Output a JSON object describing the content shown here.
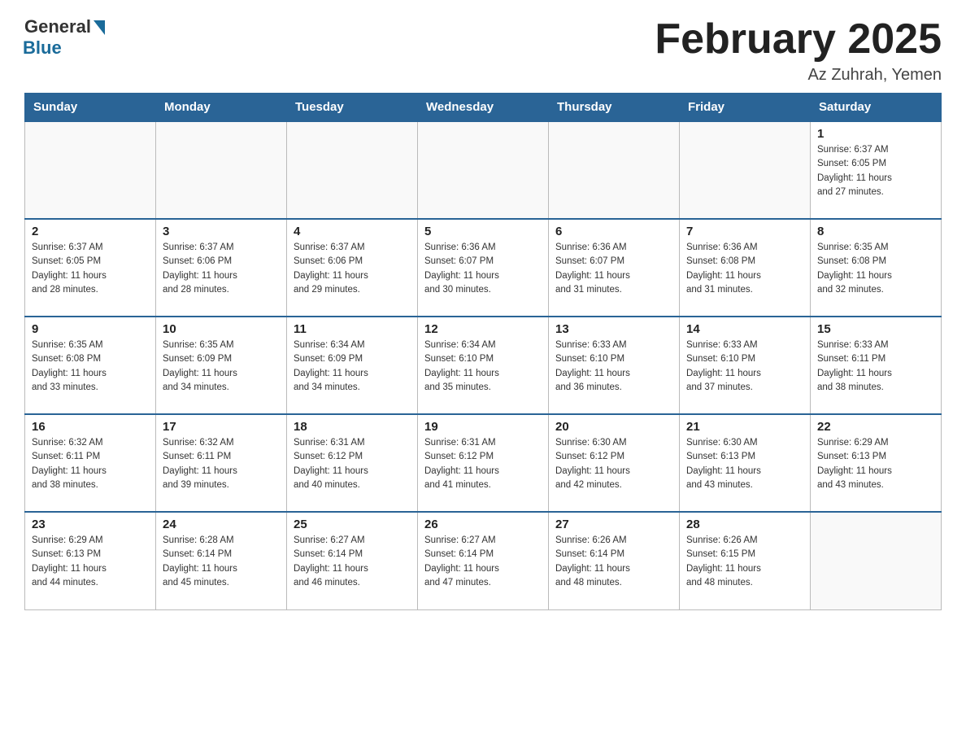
{
  "header": {
    "logo_general": "General",
    "logo_blue": "Blue",
    "month_title": "February 2025",
    "location": "Az Zuhrah, Yemen"
  },
  "weekdays": [
    "Sunday",
    "Monday",
    "Tuesday",
    "Wednesday",
    "Thursday",
    "Friday",
    "Saturday"
  ],
  "weeks": [
    [
      {
        "day": "",
        "info": ""
      },
      {
        "day": "",
        "info": ""
      },
      {
        "day": "",
        "info": ""
      },
      {
        "day": "",
        "info": ""
      },
      {
        "day": "",
        "info": ""
      },
      {
        "day": "",
        "info": ""
      },
      {
        "day": "1",
        "info": "Sunrise: 6:37 AM\nSunset: 6:05 PM\nDaylight: 11 hours\nand 27 minutes."
      }
    ],
    [
      {
        "day": "2",
        "info": "Sunrise: 6:37 AM\nSunset: 6:05 PM\nDaylight: 11 hours\nand 28 minutes."
      },
      {
        "day": "3",
        "info": "Sunrise: 6:37 AM\nSunset: 6:06 PM\nDaylight: 11 hours\nand 28 minutes."
      },
      {
        "day": "4",
        "info": "Sunrise: 6:37 AM\nSunset: 6:06 PM\nDaylight: 11 hours\nand 29 minutes."
      },
      {
        "day": "5",
        "info": "Sunrise: 6:36 AM\nSunset: 6:07 PM\nDaylight: 11 hours\nand 30 minutes."
      },
      {
        "day": "6",
        "info": "Sunrise: 6:36 AM\nSunset: 6:07 PM\nDaylight: 11 hours\nand 31 minutes."
      },
      {
        "day": "7",
        "info": "Sunrise: 6:36 AM\nSunset: 6:08 PM\nDaylight: 11 hours\nand 31 minutes."
      },
      {
        "day": "8",
        "info": "Sunrise: 6:35 AM\nSunset: 6:08 PM\nDaylight: 11 hours\nand 32 minutes."
      }
    ],
    [
      {
        "day": "9",
        "info": "Sunrise: 6:35 AM\nSunset: 6:08 PM\nDaylight: 11 hours\nand 33 minutes."
      },
      {
        "day": "10",
        "info": "Sunrise: 6:35 AM\nSunset: 6:09 PM\nDaylight: 11 hours\nand 34 minutes."
      },
      {
        "day": "11",
        "info": "Sunrise: 6:34 AM\nSunset: 6:09 PM\nDaylight: 11 hours\nand 34 minutes."
      },
      {
        "day": "12",
        "info": "Sunrise: 6:34 AM\nSunset: 6:10 PM\nDaylight: 11 hours\nand 35 minutes."
      },
      {
        "day": "13",
        "info": "Sunrise: 6:33 AM\nSunset: 6:10 PM\nDaylight: 11 hours\nand 36 minutes."
      },
      {
        "day": "14",
        "info": "Sunrise: 6:33 AM\nSunset: 6:10 PM\nDaylight: 11 hours\nand 37 minutes."
      },
      {
        "day": "15",
        "info": "Sunrise: 6:33 AM\nSunset: 6:11 PM\nDaylight: 11 hours\nand 38 minutes."
      }
    ],
    [
      {
        "day": "16",
        "info": "Sunrise: 6:32 AM\nSunset: 6:11 PM\nDaylight: 11 hours\nand 38 minutes."
      },
      {
        "day": "17",
        "info": "Sunrise: 6:32 AM\nSunset: 6:11 PM\nDaylight: 11 hours\nand 39 minutes."
      },
      {
        "day": "18",
        "info": "Sunrise: 6:31 AM\nSunset: 6:12 PM\nDaylight: 11 hours\nand 40 minutes."
      },
      {
        "day": "19",
        "info": "Sunrise: 6:31 AM\nSunset: 6:12 PM\nDaylight: 11 hours\nand 41 minutes."
      },
      {
        "day": "20",
        "info": "Sunrise: 6:30 AM\nSunset: 6:12 PM\nDaylight: 11 hours\nand 42 minutes."
      },
      {
        "day": "21",
        "info": "Sunrise: 6:30 AM\nSunset: 6:13 PM\nDaylight: 11 hours\nand 43 minutes."
      },
      {
        "day": "22",
        "info": "Sunrise: 6:29 AM\nSunset: 6:13 PM\nDaylight: 11 hours\nand 43 minutes."
      }
    ],
    [
      {
        "day": "23",
        "info": "Sunrise: 6:29 AM\nSunset: 6:13 PM\nDaylight: 11 hours\nand 44 minutes."
      },
      {
        "day": "24",
        "info": "Sunrise: 6:28 AM\nSunset: 6:14 PM\nDaylight: 11 hours\nand 45 minutes."
      },
      {
        "day": "25",
        "info": "Sunrise: 6:27 AM\nSunset: 6:14 PM\nDaylight: 11 hours\nand 46 minutes."
      },
      {
        "day": "26",
        "info": "Sunrise: 6:27 AM\nSunset: 6:14 PM\nDaylight: 11 hours\nand 47 minutes."
      },
      {
        "day": "27",
        "info": "Sunrise: 6:26 AM\nSunset: 6:14 PM\nDaylight: 11 hours\nand 48 minutes."
      },
      {
        "day": "28",
        "info": "Sunrise: 6:26 AM\nSunset: 6:15 PM\nDaylight: 11 hours\nand 48 minutes."
      },
      {
        "day": "",
        "info": ""
      }
    ]
  ]
}
